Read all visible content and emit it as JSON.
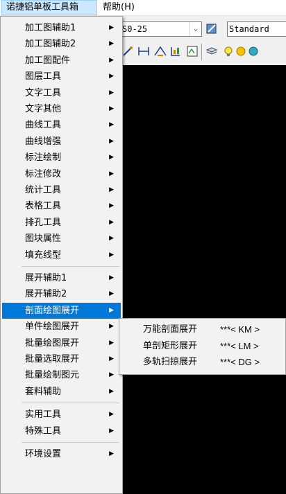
{
  "menubar": {
    "items": [
      {
        "label": "诺捷铝单板工具箱"
      },
      {
        "label": "帮助(H)"
      }
    ]
  },
  "toolbar": {
    "dimstyle_value": "S0-25",
    "textstyle_value": "Standard"
  },
  "main_menu": {
    "groups": [
      [
        {
          "label": "加工图辅助1"
        },
        {
          "label": "加工图辅助2"
        },
        {
          "label": "加工图配件"
        },
        {
          "label": "图层工具"
        },
        {
          "label": "文字工具"
        },
        {
          "label": "文字其他"
        },
        {
          "label": "曲线工具"
        },
        {
          "label": "曲线增强"
        },
        {
          "label": "标注绘制"
        },
        {
          "label": "标注修改"
        },
        {
          "label": "统计工具"
        },
        {
          "label": "表格工具"
        },
        {
          "label": "排孔工具"
        },
        {
          "label": "图块属性"
        },
        {
          "label": "填充线型"
        }
      ],
      [
        {
          "label": "展开辅助1"
        },
        {
          "label": "展开辅助2"
        },
        {
          "label": "剖面绘图展开"
        },
        {
          "label": "单件绘图展开"
        },
        {
          "label": "批量绘图展开"
        },
        {
          "label": "批量选取展开"
        },
        {
          "label": "批量绘制图元"
        },
        {
          "label": "套料辅助"
        }
      ],
      [
        {
          "label": "实用工具"
        },
        {
          "label": "特殊工具"
        }
      ],
      [
        {
          "label": "环境设置"
        }
      ]
    ]
  },
  "submenu": {
    "items": [
      {
        "label": "万能剖面展开",
        "shortcut": "***< KM >"
      },
      {
        "label": "单剖矩形展开",
        "shortcut": "***< LM >"
      },
      {
        "label": "多轨扫掠展开",
        "shortcut": "***< DG >"
      }
    ]
  },
  "colors": {
    "highlight": "#0078d7",
    "menu_bg": "#f2f2f2",
    "canvas_bg": "#000000"
  }
}
